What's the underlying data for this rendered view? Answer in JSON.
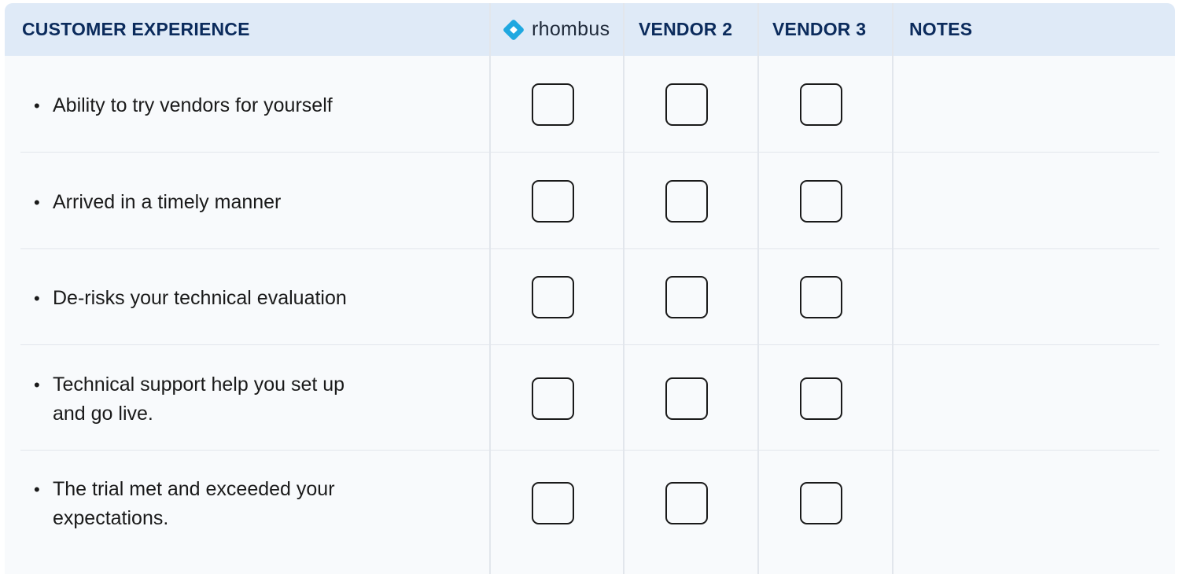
{
  "header": {
    "section_title": "CUSTOMER EXPERIENCE",
    "brand_name": "rhombus",
    "vendor2": "VENDOR 2",
    "vendor3": "VENDOR 3",
    "notes": "NOTES"
  },
  "colors": {
    "header_bg": "#dfeaf7",
    "header_text": "#0b2b5c",
    "brand_accent": "#1fa8e0"
  },
  "icons": {
    "brand_logo": "rhombus-diamond-icon",
    "checkbox": "empty-checkbox"
  },
  "rows": [
    {
      "lines": [
        "Ability to try vendors for yourself"
      ],
      "checked": [
        false,
        false,
        false
      ]
    },
    {
      "lines": [
        "Arrived in a timely manner"
      ],
      "checked": [
        false,
        false,
        false
      ]
    },
    {
      "lines": [
        "De-risks your technical evaluation"
      ],
      "checked": [
        false,
        false,
        false
      ]
    },
    {
      "lines": [
        "Technical support help you set up",
        "and go live."
      ],
      "checked": [
        false,
        false,
        false
      ]
    },
    {
      "lines": [
        "The trial met and exceeded your",
        "expectations."
      ],
      "checked": [
        false,
        false,
        false
      ]
    }
  ]
}
